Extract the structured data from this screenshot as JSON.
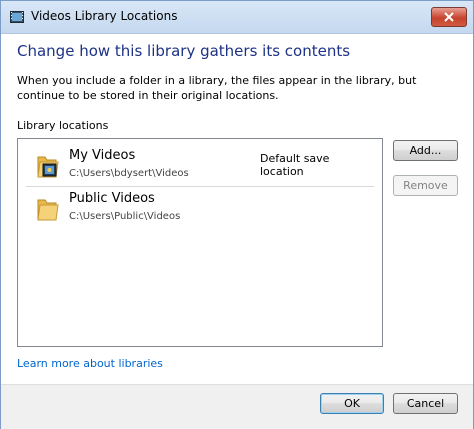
{
  "window": {
    "title": "Videos Library Locations"
  },
  "heading": "Change how this library gathers its contents",
  "description": "When you include a folder in a library, the files appear in the library, but continue to be stored in their original locations.",
  "section_label": "Library locations",
  "locations": [
    {
      "name": "My Videos",
      "path": "C:\\Users\\bdysert\\Videos",
      "badge": "Default save location",
      "icon": "video-folder-icon"
    },
    {
      "name": "Public Videos",
      "path": "C:\\Users\\Public\\Videos",
      "badge": "",
      "icon": "folder-icon"
    }
  ],
  "buttons": {
    "add": "Add...",
    "remove": "Remove",
    "ok": "OK",
    "cancel": "Cancel"
  },
  "link": "Learn more about libraries",
  "colors": {
    "heading": "#1e3287",
    "link": "#0066cc",
    "close_button": "#c7432e"
  }
}
